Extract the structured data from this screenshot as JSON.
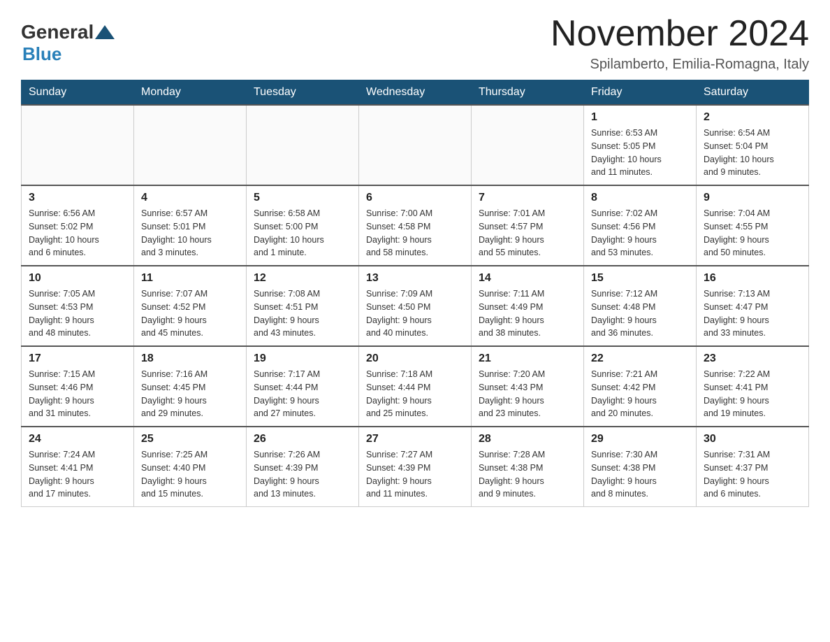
{
  "header": {
    "logo_general": "General",
    "logo_blue": "Blue",
    "month_title": "November 2024",
    "location": "Spilamberto, Emilia-Romagna, Italy"
  },
  "days_of_week": [
    "Sunday",
    "Monday",
    "Tuesday",
    "Wednesday",
    "Thursday",
    "Friday",
    "Saturday"
  ],
  "weeks": [
    {
      "days": [
        {
          "number": "",
          "info": ""
        },
        {
          "number": "",
          "info": ""
        },
        {
          "number": "",
          "info": ""
        },
        {
          "number": "",
          "info": ""
        },
        {
          "number": "",
          "info": ""
        },
        {
          "number": "1",
          "info": "Sunrise: 6:53 AM\nSunset: 5:05 PM\nDaylight: 10 hours\nand 11 minutes."
        },
        {
          "number": "2",
          "info": "Sunrise: 6:54 AM\nSunset: 5:04 PM\nDaylight: 10 hours\nand 9 minutes."
        }
      ]
    },
    {
      "days": [
        {
          "number": "3",
          "info": "Sunrise: 6:56 AM\nSunset: 5:02 PM\nDaylight: 10 hours\nand 6 minutes."
        },
        {
          "number": "4",
          "info": "Sunrise: 6:57 AM\nSunset: 5:01 PM\nDaylight: 10 hours\nand 3 minutes."
        },
        {
          "number": "5",
          "info": "Sunrise: 6:58 AM\nSunset: 5:00 PM\nDaylight: 10 hours\nand 1 minute."
        },
        {
          "number": "6",
          "info": "Sunrise: 7:00 AM\nSunset: 4:58 PM\nDaylight: 9 hours\nand 58 minutes."
        },
        {
          "number": "7",
          "info": "Sunrise: 7:01 AM\nSunset: 4:57 PM\nDaylight: 9 hours\nand 55 minutes."
        },
        {
          "number": "8",
          "info": "Sunrise: 7:02 AM\nSunset: 4:56 PM\nDaylight: 9 hours\nand 53 minutes."
        },
        {
          "number": "9",
          "info": "Sunrise: 7:04 AM\nSunset: 4:55 PM\nDaylight: 9 hours\nand 50 minutes."
        }
      ]
    },
    {
      "days": [
        {
          "number": "10",
          "info": "Sunrise: 7:05 AM\nSunset: 4:53 PM\nDaylight: 9 hours\nand 48 minutes."
        },
        {
          "number": "11",
          "info": "Sunrise: 7:07 AM\nSunset: 4:52 PM\nDaylight: 9 hours\nand 45 minutes."
        },
        {
          "number": "12",
          "info": "Sunrise: 7:08 AM\nSunset: 4:51 PM\nDaylight: 9 hours\nand 43 minutes."
        },
        {
          "number": "13",
          "info": "Sunrise: 7:09 AM\nSunset: 4:50 PM\nDaylight: 9 hours\nand 40 minutes."
        },
        {
          "number": "14",
          "info": "Sunrise: 7:11 AM\nSunset: 4:49 PM\nDaylight: 9 hours\nand 38 minutes."
        },
        {
          "number": "15",
          "info": "Sunrise: 7:12 AM\nSunset: 4:48 PM\nDaylight: 9 hours\nand 36 minutes."
        },
        {
          "number": "16",
          "info": "Sunrise: 7:13 AM\nSunset: 4:47 PM\nDaylight: 9 hours\nand 33 minutes."
        }
      ]
    },
    {
      "days": [
        {
          "number": "17",
          "info": "Sunrise: 7:15 AM\nSunset: 4:46 PM\nDaylight: 9 hours\nand 31 minutes."
        },
        {
          "number": "18",
          "info": "Sunrise: 7:16 AM\nSunset: 4:45 PM\nDaylight: 9 hours\nand 29 minutes."
        },
        {
          "number": "19",
          "info": "Sunrise: 7:17 AM\nSunset: 4:44 PM\nDaylight: 9 hours\nand 27 minutes."
        },
        {
          "number": "20",
          "info": "Sunrise: 7:18 AM\nSunset: 4:44 PM\nDaylight: 9 hours\nand 25 minutes."
        },
        {
          "number": "21",
          "info": "Sunrise: 7:20 AM\nSunset: 4:43 PM\nDaylight: 9 hours\nand 23 minutes."
        },
        {
          "number": "22",
          "info": "Sunrise: 7:21 AM\nSunset: 4:42 PM\nDaylight: 9 hours\nand 20 minutes."
        },
        {
          "number": "23",
          "info": "Sunrise: 7:22 AM\nSunset: 4:41 PM\nDaylight: 9 hours\nand 19 minutes."
        }
      ]
    },
    {
      "days": [
        {
          "number": "24",
          "info": "Sunrise: 7:24 AM\nSunset: 4:41 PM\nDaylight: 9 hours\nand 17 minutes."
        },
        {
          "number": "25",
          "info": "Sunrise: 7:25 AM\nSunset: 4:40 PM\nDaylight: 9 hours\nand 15 minutes."
        },
        {
          "number": "26",
          "info": "Sunrise: 7:26 AM\nSunset: 4:39 PM\nDaylight: 9 hours\nand 13 minutes."
        },
        {
          "number": "27",
          "info": "Sunrise: 7:27 AM\nSunset: 4:39 PM\nDaylight: 9 hours\nand 11 minutes."
        },
        {
          "number": "28",
          "info": "Sunrise: 7:28 AM\nSunset: 4:38 PM\nDaylight: 9 hours\nand 9 minutes."
        },
        {
          "number": "29",
          "info": "Sunrise: 7:30 AM\nSunset: 4:38 PM\nDaylight: 9 hours\nand 8 minutes."
        },
        {
          "number": "30",
          "info": "Sunrise: 7:31 AM\nSunset: 4:37 PM\nDaylight: 9 hours\nand 6 minutes."
        }
      ]
    }
  ]
}
